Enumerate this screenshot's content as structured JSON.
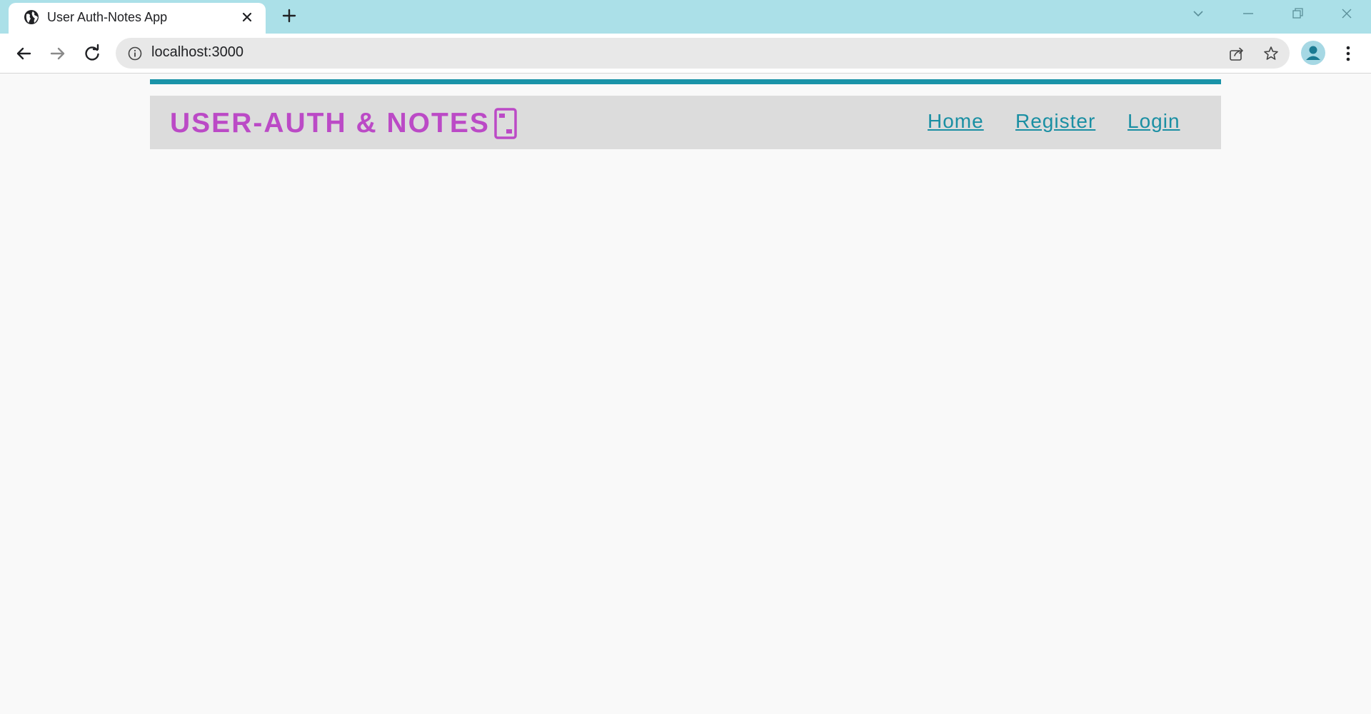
{
  "browser": {
    "tab": {
      "title": "User Auth-Notes App",
      "favicon": "globe-icon"
    },
    "address_bar": {
      "url": "localhost:3000"
    },
    "accent_color": "#abe0e8"
  },
  "app": {
    "brand": {
      "title": "USER-AUTH & NOTES",
      "icon": "tablet-icon",
      "color": "#bb4ac6"
    },
    "nav": {
      "links": [
        {
          "label": "Home"
        },
        {
          "label": "Register"
        },
        {
          "label": "Login"
        }
      ],
      "link_color": "#1a8fa3"
    },
    "accent_bar_color": "#1a93a8",
    "navbar_bg": "#dcdcdc"
  }
}
